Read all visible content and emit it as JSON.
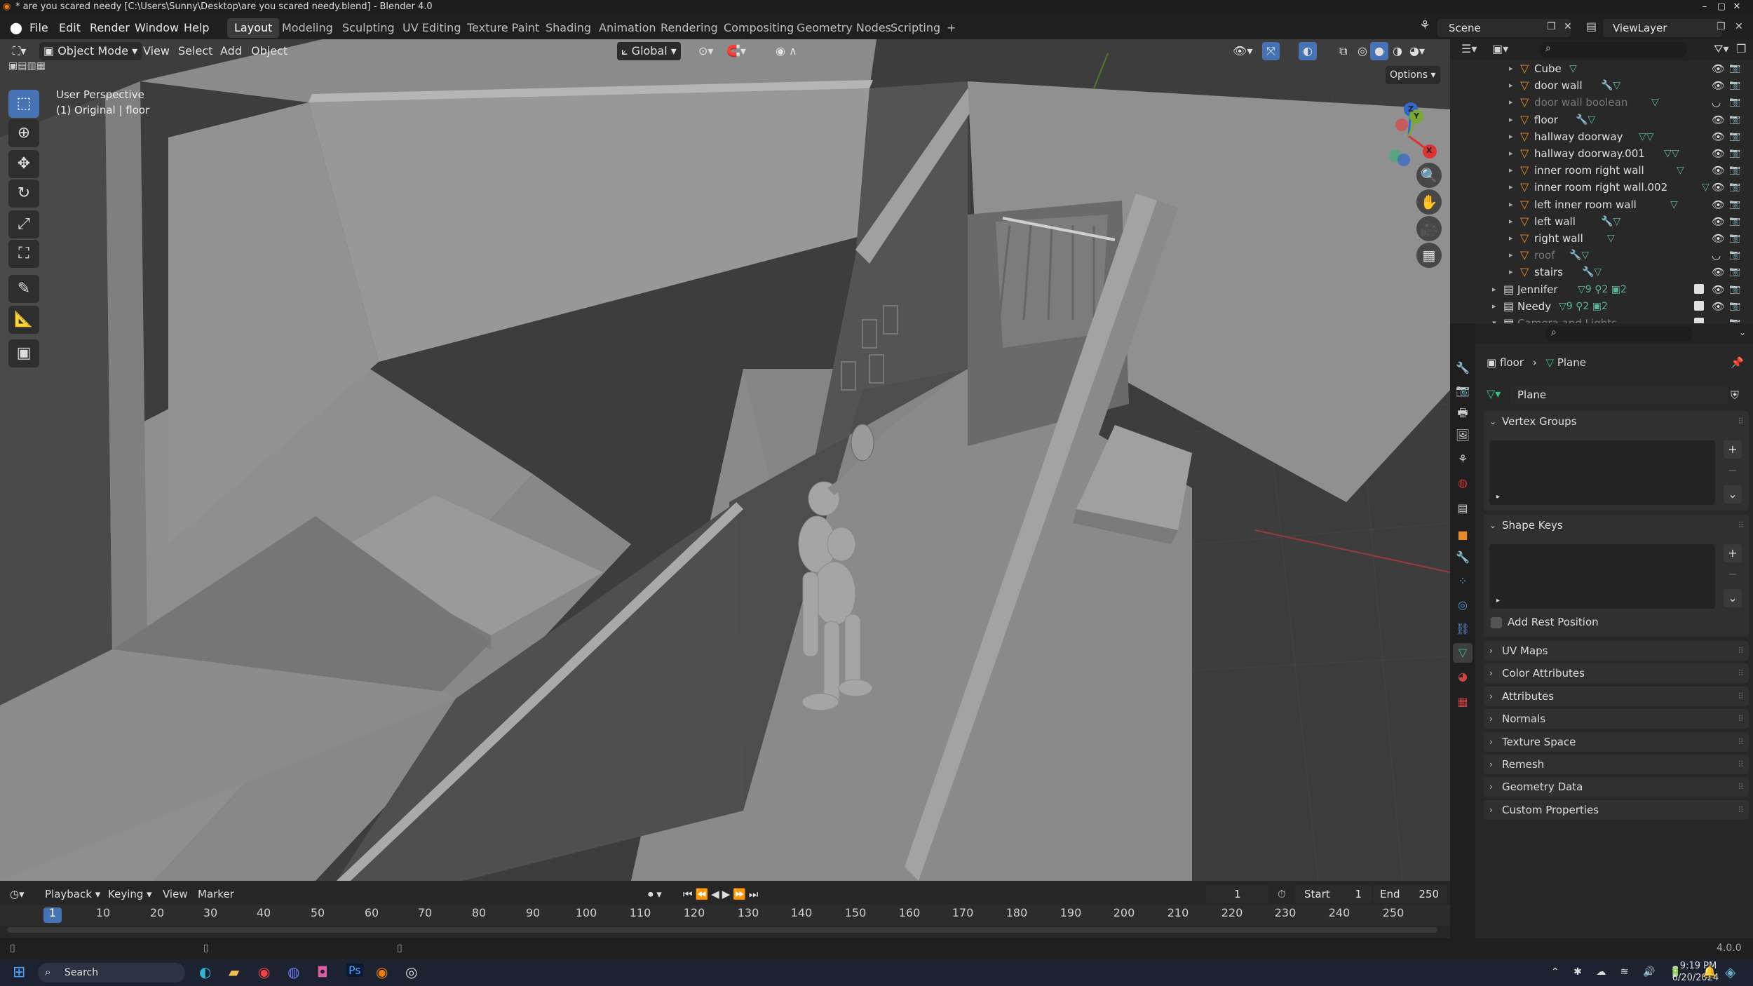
{
  "window": {
    "title": "* are you scared needy [C:\\Users\\Sunny\\Desktop\\are you scared needy.blend] - Blender 4.0",
    "controls": [
      "–",
      "▢",
      "✕"
    ]
  },
  "menu": {
    "items": [
      "File",
      "Edit",
      "Render",
      "Window",
      "Help"
    ],
    "workspaces": [
      "Layout",
      "Modeling",
      "Sculpting",
      "UV Editing",
      "Texture Paint",
      "Shading",
      "Animation",
      "Rendering",
      "Compositing",
      "Geometry Nodes",
      "Scripting"
    ],
    "active_workspace": "Layout",
    "add_tab": "+",
    "scene": "Scene",
    "view_layer": "ViewLayer"
  },
  "viewport": {
    "mode": "Object Mode",
    "menus": [
      "View",
      "Select",
      "Add",
      "Object"
    ],
    "orientation": "Global",
    "options": "Options",
    "overlay_line1": "User Perspective",
    "overlay_line2": "(1) Original | floor",
    "gizmo": {
      "x": "X",
      "y": "Y",
      "z": "Z"
    }
  },
  "timeline": {
    "menus": [
      "Playback",
      "Keying",
      "View",
      "Marker"
    ],
    "current_frame": "1",
    "start_label": "Start",
    "start": "1",
    "end_label": "End",
    "end": "250",
    "ticks": [
      "1",
      "10",
      "20",
      "30",
      "40",
      "50",
      "60",
      "70",
      "80",
      "90",
      "100",
      "110",
      "120",
      "130",
      "140",
      "150",
      "160",
      "170",
      "180",
      "190",
      "200",
      "210",
      "220",
      "230",
      "240",
      "250"
    ]
  },
  "outliner": {
    "rows": [
      {
        "name": "Cube",
        "type": "mesh",
        "dim": false,
        "mods": "▽"
      },
      {
        "name": "door wall",
        "type": "mesh",
        "dim": false,
        "mods": "🔧▽"
      },
      {
        "name": "door wall boolean",
        "type": "mesh",
        "dim": true,
        "mods": "▽"
      },
      {
        "name": "floor",
        "type": "mesh",
        "dim": false,
        "mods": "🔧▽"
      },
      {
        "name": "hallway doorway",
        "type": "mesh",
        "dim": false,
        "mods": "▽▽"
      },
      {
        "name": "hallway doorway.001",
        "type": "mesh",
        "dim": false,
        "mods": "▽▽"
      },
      {
        "name": "inner room right wall",
        "type": "mesh",
        "dim": false,
        "mods": "▽"
      },
      {
        "name": "inner room right wall.002",
        "type": "mesh",
        "dim": false,
        "mods": "▽"
      },
      {
        "name": "left inner room wall",
        "type": "mesh",
        "dim": false,
        "mods": "▽"
      },
      {
        "name": "left wall",
        "type": "mesh",
        "dim": false,
        "mods": "🔧▽"
      },
      {
        "name": "right wall",
        "type": "mesh",
        "dim": false,
        "mods": "▽"
      },
      {
        "name": "roof",
        "type": "mesh",
        "dim": true,
        "mods": "🔧▽"
      },
      {
        "name": "stairs",
        "type": "mesh",
        "dim": false,
        "mods": "🔧▽"
      },
      {
        "name": "Jennifer",
        "type": "collection",
        "dim": false,
        "mods": "▽9 ⚲2 ▣2"
      },
      {
        "name": "Needy",
        "type": "collection",
        "dim": false,
        "mods": "▽9 ⚲2 ▣2"
      },
      {
        "name": "Camera and Lights",
        "type": "collection",
        "dim": true,
        "mods": ""
      }
    ]
  },
  "properties": {
    "breadcrumb_object": "floor",
    "breadcrumb_data": "Plane",
    "mesh_name": "Plane",
    "vertex_groups": "Vertex Groups",
    "shape_keys": "Shape Keys",
    "add_rest_position": "Add Rest Position",
    "collapsed_panels": [
      "UV Maps",
      "Color Attributes",
      "Attributes",
      "Normals",
      "Texture Space",
      "Remesh",
      "Geometry Data",
      "Custom Properties"
    ]
  },
  "status": {
    "version": "4.0.0"
  },
  "taskbar": {
    "search": "Search",
    "time": "9:19 PM",
    "date": "6/20/2024"
  }
}
